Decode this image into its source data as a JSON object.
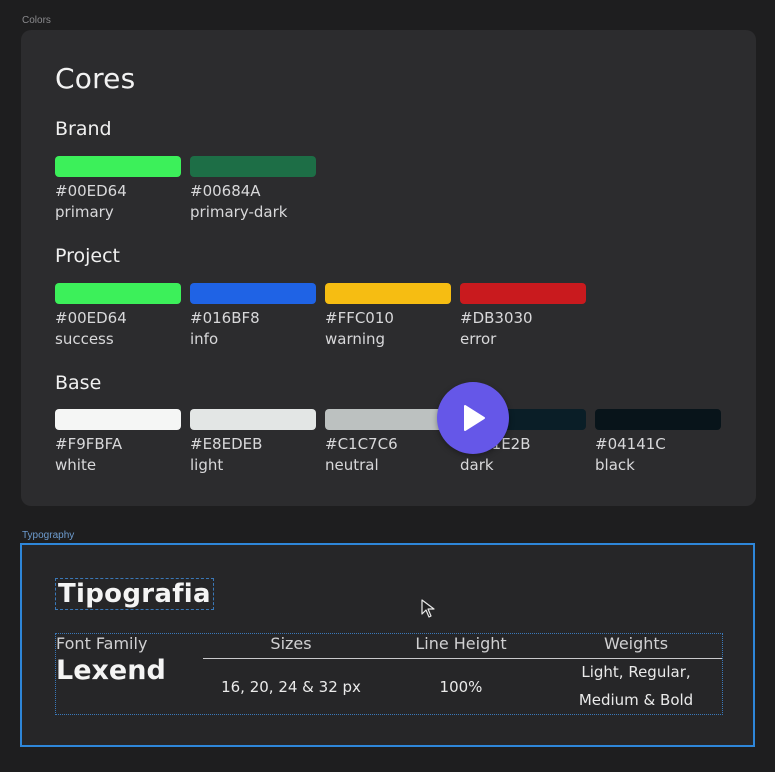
{
  "frames": {
    "colors_label": "Colors",
    "typography_label": "Typography"
  },
  "colors": {
    "title": "Cores",
    "groups": [
      {
        "name": "Brand",
        "swatches": [
          {
            "hex": "#00ED64",
            "name": "primary",
            "color": "#3cf05a"
          },
          {
            "hex": "#00684A",
            "name": "primary-dark",
            "color": "#1d6e46"
          }
        ]
      },
      {
        "name": "Project",
        "swatches": [
          {
            "hex": "#00ED64",
            "name": "success",
            "color": "#3cf05a"
          },
          {
            "hex": "#016BF8",
            "name": "info",
            "color": "#1f63e5"
          },
          {
            "hex": "#FFC010",
            "name": "warning",
            "color": "#f6bd12"
          },
          {
            "hex": "#DB3030",
            "name": "error",
            "color": "#c91a1e"
          }
        ]
      },
      {
        "name": "Base",
        "swatches": [
          {
            "hex": "#F9FBFA",
            "name": "white",
            "color": "#f5f6f5"
          },
          {
            "hex": "#E8EDEB",
            "name": "light",
            "color": "#e3e6e5"
          },
          {
            "hex": "#C1C7C6",
            "name": "neutral",
            "color": "#bcc1c0"
          },
          {
            "hex": "#001E2B",
            "name": "dark",
            "color": "#0a1e27"
          },
          {
            "hex": "#04141C",
            "name": "black",
            "color": "#08141a"
          }
        ]
      }
    ]
  },
  "typography": {
    "title": "Tipografia",
    "font_family_label": "Font Family",
    "font_family_value": "Lexend",
    "headers": {
      "sizes": "Sizes",
      "line_height": "Line Height",
      "weights": "Weights"
    },
    "values": {
      "sizes": "16, 20, 24 & 32 px",
      "line_height": "100%",
      "weights_line1": "Light, Regular,",
      "weights_line2": "Medium & Bold"
    }
  },
  "overlay": {
    "play_icon": "play-icon",
    "play_color": "#6557e8",
    "cursor_icon": "cursor-arrow-icon"
  }
}
